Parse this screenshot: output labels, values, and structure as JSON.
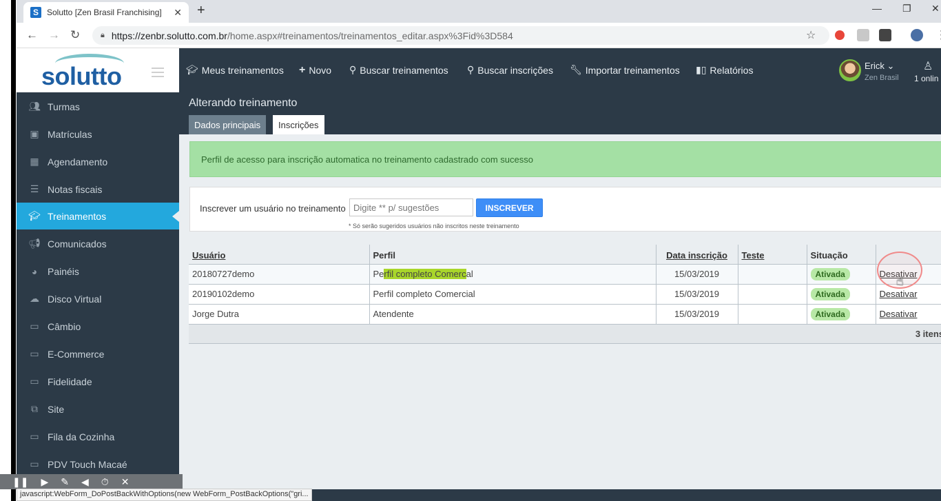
{
  "browser": {
    "tab_title": "Solutto [Zen Brasil Franchising]",
    "favicon_letter": "S",
    "new_tab": "+",
    "url_host": "https://zenbr.solutto.com.br",
    "url_path": "/home.aspx#treinamentos/treinamentos_editar.aspx%3Fid%3D584"
  },
  "header": {
    "logo": "solutto",
    "nav": [
      {
        "label": "Meus treinamentos",
        "icon": "graduation-cap-icon"
      },
      {
        "label": "Novo",
        "icon": "plus-icon"
      },
      {
        "label": "Buscar treinamentos",
        "icon": "search-icon"
      },
      {
        "label": "Buscar inscrições",
        "icon": "search-icon"
      },
      {
        "label": "Importar treinamentos",
        "icon": "wrench-icon"
      },
      {
        "label": "Relatórios",
        "icon": "bar-chart-icon"
      }
    ],
    "user_name": "Erick",
    "user_org": "Zen Brasil",
    "online": "1 onlin"
  },
  "sidebar": {
    "items": [
      {
        "label": "Turmas",
        "icon": "users-icon"
      },
      {
        "label": "Matrículas",
        "icon": "id-card-icon"
      },
      {
        "label": "Agendamento",
        "icon": "calendar-icon"
      },
      {
        "label": "Notas fiscais",
        "icon": "list-icon"
      },
      {
        "label": "Treinamentos",
        "icon": "graduation-cap-icon",
        "active": true
      },
      {
        "label": "Comunicados",
        "icon": "megaphone-icon"
      },
      {
        "label": "Painéis",
        "icon": "pie-chart-icon"
      },
      {
        "label": "Disco Virtual",
        "icon": "cloud-icon"
      },
      {
        "label": "Câmbio",
        "icon": "window-icon"
      },
      {
        "label": "E-Commerce",
        "icon": "window-icon"
      },
      {
        "label": "Fidelidade",
        "icon": "window-icon"
      },
      {
        "label": "Site",
        "icon": "sitemap-icon"
      },
      {
        "label": "Fila da Cozinha",
        "icon": "window-icon"
      },
      {
        "label": "PDV Touch Macaé",
        "icon": "window-icon"
      }
    ]
  },
  "page": {
    "title": "Alterando treinamento",
    "tabs": [
      "Dados principais",
      "Inscrições"
    ],
    "alert": "Perfil de acesso para inscrição automatica no treinamento cadastrado com sucesso",
    "subscribe": {
      "label": "Inscrever um usuário no treinamento",
      "placeholder": "Digite ** p/ sugestões",
      "button": "INSCREVER",
      "note": "* Só serão sugeridos usuários não inscritos neste treinamento"
    }
  },
  "grid": {
    "headers": [
      "Usuário",
      "Perfil",
      "Data inscrição",
      "Teste",
      "Situação",
      ""
    ],
    "rows": [
      {
        "usuario": "20180727demo",
        "perfil_a": "Pe",
        "perfil_hl": "rfil completo Comerc",
        "perfil_b": "al",
        "data": "15/03/2019",
        "teste": "",
        "situacao": "Ativada",
        "acao": "Desativar"
      },
      {
        "usuario": "20190102demo",
        "perfil": "Perfil completo Comercial",
        "data": "15/03/2019",
        "teste": "",
        "situacao": "Ativada",
        "acao": "Desativar"
      },
      {
        "usuario": "Jorge Dutra",
        "perfil": "Atendente",
        "data": "15/03/2019",
        "teste": "",
        "situacao": "Ativada",
        "acao": "Desativar"
      }
    ],
    "footer": "3  itens"
  },
  "status_bar": {
    "url": "javascript:WebForm_DoPostBackWithOptions(new WebForm_PostBackOptions(\"gri..."
  }
}
